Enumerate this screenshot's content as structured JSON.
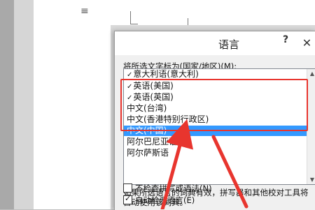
{
  "background": {
    "page_mark": "≡"
  },
  "dialog": {
    "title": "语言",
    "help_label": "?",
    "close_label": "✕",
    "mark_label": "将所选文字标为(国家/地区)(M):",
    "list_items": [
      {
        "text": "意大利语(意大利)",
        "checked": true,
        "selected": false
      },
      {
        "text": "英语(美国)",
        "checked": true,
        "selected": false
      },
      {
        "text": "英语(英国)",
        "checked": true,
        "selected": false
      },
      {
        "text": "中文(台湾)",
        "checked": false,
        "selected": false
      },
      {
        "text": "中文(香港特别行政区)",
        "checked": false,
        "selected": false
      },
      {
        "text": "中文(中国)",
        "checked": false,
        "selected": true
      },
      {
        "text": "阿尔巴尼亚语",
        "checked": false,
        "selected": false
      },
      {
        "text": "阿尔萨斯语",
        "checked": false,
        "selected": false
      }
    ],
    "info_line1": "如果所选语言的词典有效，拼写器和其他校对工具将",
    "info_line2": "自动使用该词典。",
    "checkbox_no_proof": {
      "label": "不检查拼写或语法(N)",
      "checked": false
    },
    "checkbox_detect": {
      "label": "自动检测语言(E)",
      "checked": true
    }
  },
  "annotation": {
    "highlight_color": "#e8352e",
    "arrow_color": "#e8352e"
  },
  "colors": {
    "selection": "#3399ff"
  }
}
